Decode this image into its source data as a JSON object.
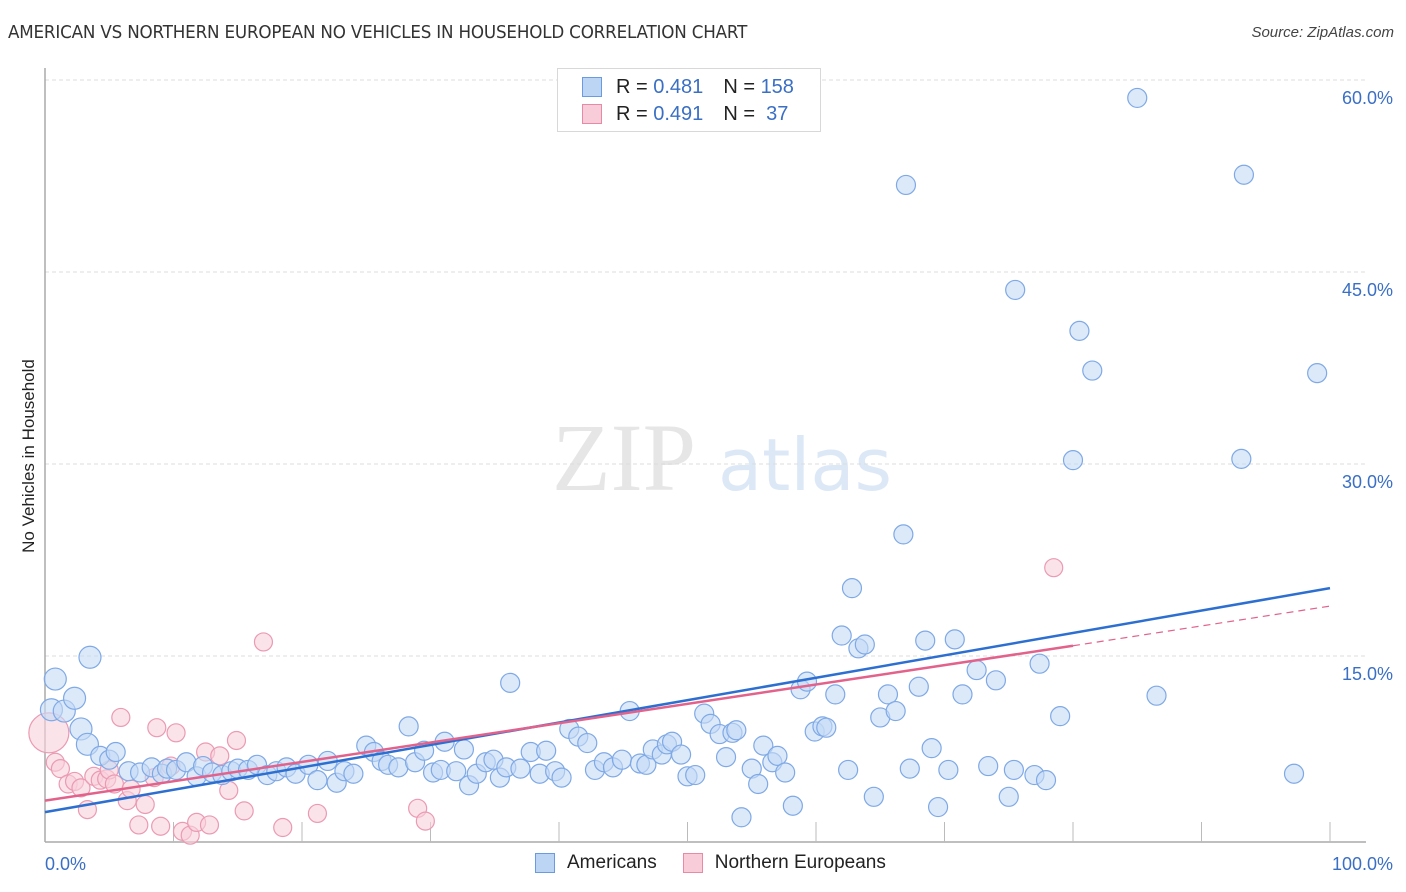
{
  "title": "AMERICAN VS NORTHERN EUROPEAN NO VEHICLES IN HOUSEHOLD CORRELATION CHART",
  "source": "Source: ZipAtlas.com",
  "watermark": {
    "part1": "ZIP",
    "part2": "atlas"
  },
  "legend": {
    "rows": [
      {
        "r_label": "R = ",
        "r_value": "0.481",
        "n_label": "N = ",
        "n_value": "158",
        "color": "#a9c8f0",
        "border": "#6a9ae0"
      },
      {
        "r_label": "R = ",
        "r_value": "0.491",
        "n_label": "N = ",
        "n_value": " 37",
        "color": "#f7c5d4",
        "border": "#e88aa6"
      }
    ]
  },
  "chart_data": {
    "type": "scatter",
    "title": "AMERICAN VS NORTHERN EUROPEAN NO VEHICLES IN HOUSEHOLD CORRELATION CHART",
    "xlabel": "",
    "ylabel": "No Vehicles in Household",
    "xlim": [
      0,
      100
    ],
    "ylim": [
      0,
      62
    ],
    "x_tick_labels": [
      "0.0%",
      "100.0%"
    ],
    "y_ticks": [
      15,
      30,
      45,
      60
    ],
    "y_tick_labels": [
      "15.0%",
      "30.0%",
      "45.0%",
      "60.0%"
    ],
    "grid": "horizontal-dashed",
    "legend_position": "bottom-center",
    "series": [
      {
        "name": "Americans",
        "color": "#7fa9e6",
        "fill": "#c5daf5",
        "trendline": {
          "x": [
            0,
            100
          ],
          "y": [
            2.8,
            20.3
          ],
          "color": "#2d6fd1"
        },
        "points": [
          [
            0.5,
            10.8
          ],
          [
            0.8,
            13.2
          ],
          [
            1.5,
            10.7
          ],
          [
            2.3,
            11.7
          ],
          [
            2.8,
            9.3
          ],
          [
            3.5,
            14.9
          ],
          [
            3.3,
            8.1
          ],
          [
            4.3,
            7.2
          ],
          [
            5.0,
            6.9
          ],
          [
            5.5,
            7.5
          ],
          [
            6.5,
            6.0
          ],
          [
            7.4,
            5.9
          ],
          [
            8.3,
            6.3
          ],
          [
            9.1,
            5.8
          ],
          [
            9.5,
            6.2
          ],
          [
            10.2,
            6.1
          ],
          [
            11.0,
            6.7
          ],
          [
            11.8,
            5.6
          ],
          [
            12.3,
            6.4
          ],
          [
            13.0,
            5.9
          ],
          [
            13.8,
            5.7
          ],
          [
            14.5,
            6.0
          ],
          [
            15.0,
            6.2
          ],
          [
            15.8,
            6.1
          ],
          [
            16.5,
            6.5
          ],
          [
            17.3,
            5.7
          ],
          [
            18.0,
            6.0
          ],
          [
            18.8,
            6.3
          ],
          [
            19.5,
            5.8
          ],
          [
            20.5,
            6.5
          ],
          [
            21.2,
            5.3
          ],
          [
            22.0,
            6.8
          ],
          [
            22.7,
            5.1
          ],
          [
            23.3,
            6.0
          ],
          [
            24.0,
            5.8
          ],
          [
            25.0,
            8.0
          ],
          [
            25.6,
            7.5
          ],
          [
            26.2,
            6.8
          ],
          [
            26.7,
            6.5
          ],
          [
            27.5,
            6.3
          ],
          [
            28.3,
            9.5
          ],
          [
            28.8,
            6.7
          ],
          [
            29.5,
            7.6
          ],
          [
            30.2,
            5.9
          ],
          [
            30.8,
            6.1
          ],
          [
            31.1,
            8.3
          ],
          [
            32.0,
            6.0
          ],
          [
            32.6,
            7.7
          ],
          [
            33.0,
            4.9
          ],
          [
            33.6,
            5.8
          ],
          [
            34.3,
            6.7
          ],
          [
            34.9,
            6.9
          ],
          [
            35.4,
            5.5
          ],
          [
            35.9,
            6.3
          ],
          [
            36.2,
            12.9
          ],
          [
            37.0,
            6.2
          ],
          [
            37.8,
            7.5
          ],
          [
            38.5,
            5.8
          ],
          [
            39.0,
            7.6
          ],
          [
            39.7,
            6.0
          ],
          [
            40.2,
            5.5
          ],
          [
            40.8,
            9.3
          ],
          [
            41.5,
            8.7
          ],
          [
            42.2,
            8.2
          ],
          [
            42.8,
            6.1
          ],
          [
            43.5,
            6.7
          ],
          [
            44.2,
            6.3
          ],
          [
            44.9,
            6.9
          ],
          [
            45.5,
            10.7
          ],
          [
            46.3,
            6.6
          ],
          [
            46.8,
            6.5
          ],
          [
            47.3,
            7.7
          ],
          [
            48.0,
            7.3
          ],
          [
            48.4,
            8.1
          ],
          [
            48.8,
            8.3
          ],
          [
            49.5,
            7.3
          ],
          [
            50.0,
            5.6
          ],
          [
            50.6,
            5.7
          ],
          [
            51.3,
            10.5
          ],
          [
            51.8,
            9.7
          ],
          [
            52.5,
            8.9
          ],
          [
            53.0,
            7.1
          ],
          [
            53.5,
            9.0
          ],
          [
            53.8,
            9.2
          ],
          [
            54.2,
            2.4
          ],
          [
            55.0,
            6.2
          ],
          [
            55.5,
            5.0
          ],
          [
            55.9,
            8.0
          ],
          [
            56.6,
            6.7
          ],
          [
            57.0,
            7.2
          ],
          [
            57.6,
            5.9
          ],
          [
            58.2,
            3.3
          ],
          [
            58.8,
            12.4
          ],
          [
            59.3,
            13.0
          ],
          [
            59.9,
            9.1
          ],
          [
            60.5,
            9.5
          ],
          [
            60.8,
            9.4
          ],
          [
            61.5,
            12.0
          ],
          [
            62.0,
            16.6
          ],
          [
            62.5,
            6.1
          ],
          [
            62.8,
            20.3
          ],
          [
            63.3,
            15.6
          ],
          [
            63.8,
            15.9
          ],
          [
            64.5,
            4.0
          ],
          [
            65.0,
            10.2
          ],
          [
            65.6,
            12.0
          ],
          [
            66.2,
            10.7
          ],
          [
            66.8,
            24.5
          ],
          [
            67.0,
            51.8
          ],
          [
            67.3,
            6.2
          ],
          [
            68.0,
            12.6
          ],
          [
            68.5,
            16.2
          ],
          [
            69.0,
            7.8
          ],
          [
            69.5,
            3.2
          ],
          [
            70.3,
            6.1
          ],
          [
            70.8,
            16.3
          ],
          [
            71.4,
            12.0
          ],
          [
            72.5,
            13.9
          ],
          [
            73.4,
            6.4
          ],
          [
            74.0,
            13.1
          ],
          [
            75.0,
            4.0
          ],
          [
            75.4,
            6.1
          ],
          [
            75.5,
            43.6
          ],
          [
            77.0,
            5.7
          ],
          [
            77.4,
            14.4
          ],
          [
            77.9,
            5.3
          ],
          [
            79.0,
            10.3
          ],
          [
            80.0,
            30.3
          ],
          [
            80.5,
            40.4
          ],
          [
            81.5,
            37.3
          ],
          [
            85.0,
            58.6
          ],
          [
            86.5,
            11.9
          ],
          [
            93.3,
            52.6
          ],
          [
            93.1,
            30.4
          ],
          [
            97.2,
            5.8
          ],
          [
            99.0,
            37.1
          ]
        ]
      },
      {
        "name": "Northern Europeans",
        "color": "#eb9ab3",
        "fill": "#f9d0dc",
        "trendline": {
          "x": [
            0,
            80
          ],
          "y": [
            3.7,
            15.8
          ],
          "extended_to": [
            100,
            18.9
          ],
          "color": "#e2628b"
        },
        "points": [
          [
            0.3,
            9.0
          ],
          [
            0.8,
            6.7
          ],
          [
            1.2,
            6.2
          ],
          [
            1.8,
            5.0
          ],
          [
            2.3,
            5.2
          ],
          [
            2.8,
            4.7
          ],
          [
            3.3,
            3.0
          ],
          [
            3.8,
            5.6
          ],
          [
            4.3,
            5.3
          ],
          [
            4.8,
            5.4
          ],
          [
            5.0,
            6.1
          ],
          [
            5.4,
            5.0
          ],
          [
            5.9,
            10.2
          ],
          [
            6.4,
            3.7
          ],
          [
            6.7,
            4.6
          ],
          [
            7.3,
            1.8
          ],
          [
            7.8,
            3.4
          ],
          [
            8.5,
            5.5
          ],
          [
            8.7,
            9.4
          ],
          [
            9.0,
            1.7
          ],
          [
            9.8,
            6.4
          ],
          [
            10.2,
            9.0
          ],
          [
            10.7,
            1.3
          ],
          [
            11.3,
            1.0
          ],
          [
            11.8,
            2.0
          ],
          [
            12.5,
            7.5
          ],
          [
            12.8,
            1.8
          ],
          [
            13.6,
            7.2
          ],
          [
            14.3,
            4.5
          ],
          [
            14.9,
            8.4
          ],
          [
            15.5,
            2.9
          ],
          [
            17.0,
            16.1
          ],
          [
            18.5,
            1.6
          ],
          [
            21.2,
            2.7
          ],
          [
            29.0,
            3.1
          ],
          [
            29.6,
            2.1
          ],
          [
            78.5,
            21.9
          ]
        ]
      }
    ]
  },
  "bottom_legend": [
    {
      "label": "Americans",
      "color": "#a9c8f0",
      "border": "#6a9ae0"
    },
    {
      "label": "Northern Europeans",
      "color": "#f7c5d4",
      "border": "#e88aa6"
    }
  ]
}
